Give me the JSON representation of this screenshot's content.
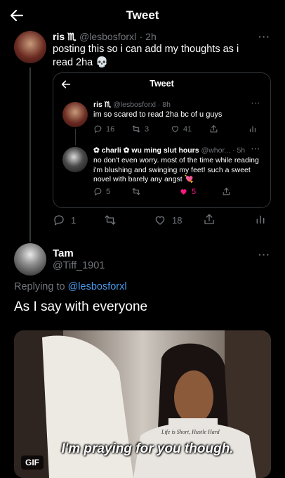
{
  "header": {
    "title": "Tweet",
    "back_icon": "arrow-left-icon"
  },
  "main_tweet": {
    "name": "ris ♏︎",
    "handle": "@lesbosforxl",
    "time": "· 2h",
    "text": "posting this so i can add my thoughts as i read 2ha 💀",
    "more": "···",
    "stats": {
      "replies": "1",
      "retweets": "",
      "likes": "18"
    }
  },
  "quote": {
    "header_title": "Tweet",
    "tweet1": {
      "name": "ris ♏︎",
      "handle": "@lesbosforxl",
      "time": "· 8h",
      "text": "im so scared to read 2ha bc of u guys",
      "replies": "16",
      "retweets": "3",
      "likes": "41"
    },
    "tweet2": {
      "name": "✿ charli ✿ wu ming slut hours",
      "handle": "@whor...",
      "time": "· 5h",
      "text": "no don't even worry. most of the time while reading i'm blushing and swinging my feet! such a sweet novel with barely any angst 💘",
      "replies": "5",
      "retweets": "",
      "likes": "5"
    }
  },
  "reply": {
    "name": "Tam",
    "handle": "@Tiff_1901",
    "replying_prefix": "Replying to",
    "replying_to": "@lesbosforxl",
    "text": "As I say with everyone",
    "gif_badge": "GIF",
    "gif_caption": "I'm praying for you though.",
    "gif_tshirt_text": "Life is Short, Hustle Hard"
  },
  "colors": {
    "background": "#000000",
    "muted": "#71767b",
    "link": "#4a99e9",
    "like_active": "#f91880",
    "border": "#2f3336"
  }
}
